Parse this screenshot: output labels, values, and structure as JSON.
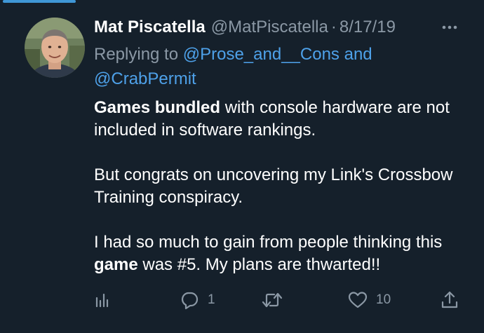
{
  "colors": {
    "background": "#15202b",
    "text_primary": "#ffffff",
    "text_secondary": "#8b98a5",
    "link": "#4ea1e9",
    "accent_bar": "#3f97d6"
  },
  "tweet": {
    "author": {
      "display_name": "Mat Piscatella",
      "handle": "@MatPiscatella",
      "avatar_icon": "profile-photo"
    },
    "dot": "·",
    "date": "8/17/19",
    "more_icon": "more-horizontal-icon",
    "replying_to": {
      "prefix": "Replying to",
      "mention_1": "@Prose_and__Cons",
      "joiner": "and",
      "mention_2": "@CrabPermit"
    },
    "body": {
      "p1": {
        "bold": "Games bundled",
        "rest": " with console hardware are not included in software rankings."
      },
      "p2": "But congrats on uncovering my Link's Crossbow Training conspiracy.",
      "p3": {
        "before": "I had so much to gain from people thinking this ",
        "bold": "game",
        "after": " was #5.  My plans are thwarted!!"
      }
    },
    "actions": {
      "analytics_icon": "analytics-icon",
      "reply_icon": "reply-icon",
      "reply_count": "1",
      "retweet_icon": "retweet-icon",
      "like_icon": "like-heart-icon",
      "like_count": "10",
      "share_icon": "share-icon"
    }
  }
}
